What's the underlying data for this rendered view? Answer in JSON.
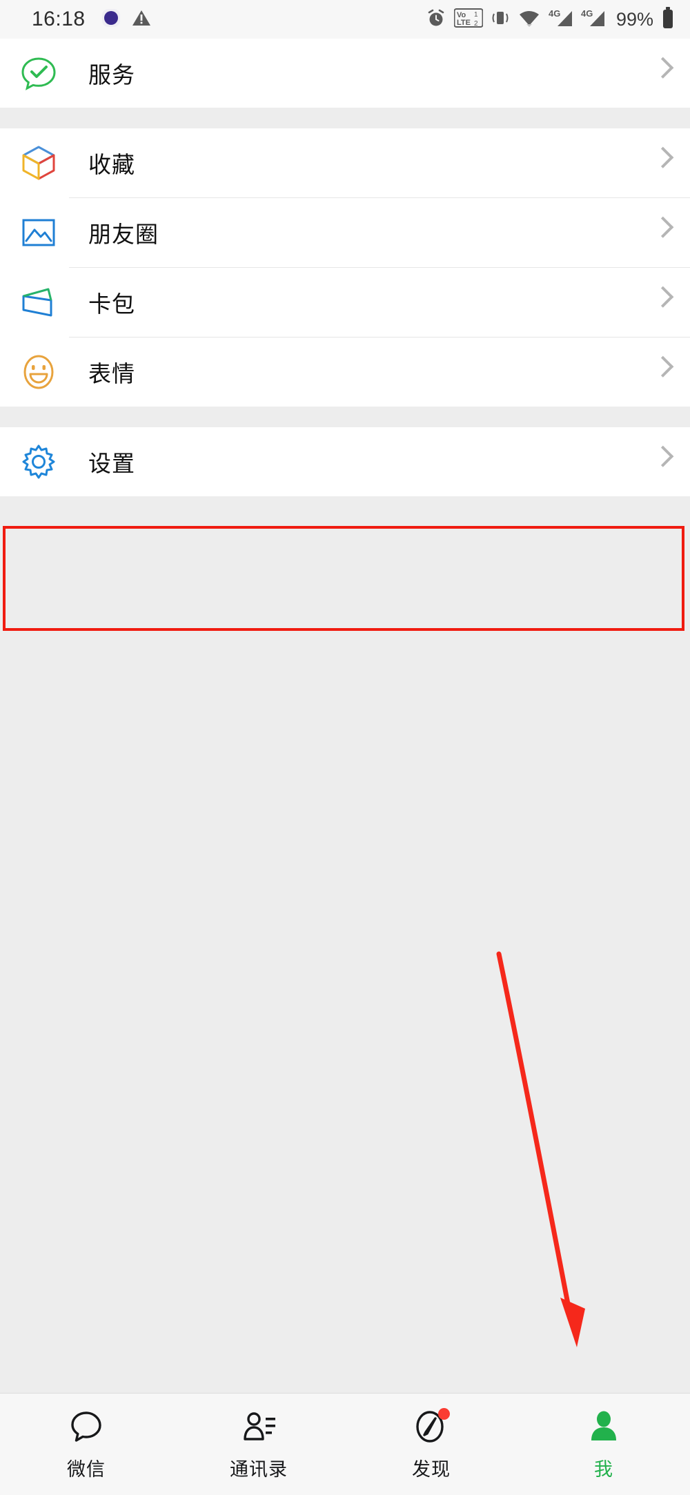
{
  "status_bar": {
    "time": "16:18",
    "battery_percent": "99%",
    "icons": [
      "browser-app-icon",
      "warning-triangle-icon",
      "alarm-clock-icon",
      "volte-dual-sim-icon",
      "vibrate-mode-icon",
      "wifi-icon",
      "signal-4g-sim1-icon",
      "signal-4g-sim2-icon",
      "battery-icon"
    ]
  },
  "list": {
    "top_group": [
      {
        "label": "服务",
        "icon": "services-chat-check-icon",
        "icon_color": "#2fbb52"
      }
    ],
    "middle_group": [
      {
        "label": "收藏",
        "icon": "favorites-cube-icon",
        "icon_color": "#4a90d9"
      },
      {
        "label": "朋友圈",
        "icon": "moments-photo-icon",
        "icon_color": "#1f7fd4"
      },
      {
        "label": "卡包",
        "icon": "cards-wallet-icon",
        "icon_color": "#1f7fd4"
      },
      {
        "label": "表情",
        "icon": "stickers-smiley-icon",
        "icon_color": "#e8a33d"
      }
    ],
    "settings_group": [
      {
        "label": "设置",
        "icon": "settings-gear-icon",
        "icon_color": "#1f86d9"
      }
    ]
  },
  "annotations": {
    "highlight_color": "#f01c10",
    "arrow_color": "#f01c10",
    "highlight_target": "设置",
    "arrow_target": "我"
  },
  "tab_bar": {
    "active_color": "#22b14c",
    "inactive_color": "#17181a",
    "tabs": [
      {
        "label": "微信",
        "icon": "chat-bubble-icon",
        "active": false,
        "badge": false
      },
      {
        "label": "通讯录",
        "icon": "contacts-icon",
        "active": false,
        "badge": false
      },
      {
        "label": "发现",
        "icon": "discover-compass-icon",
        "active": false,
        "badge": true
      },
      {
        "label": "我",
        "icon": "profile-person-icon",
        "active": true,
        "badge": false
      }
    ]
  }
}
